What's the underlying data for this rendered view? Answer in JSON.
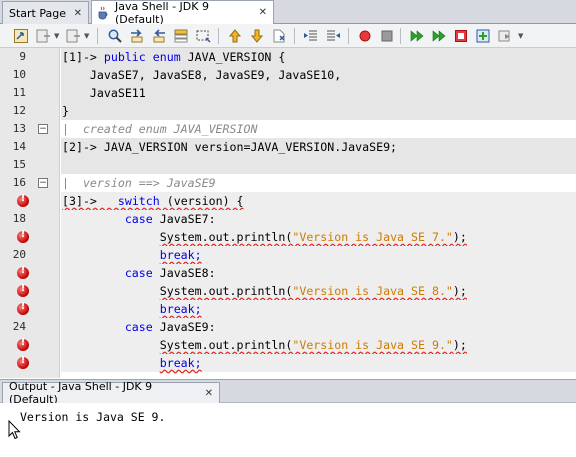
{
  "tabs": [
    {
      "label": "Start Page",
      "close": "✕"
    },
    {
      "label": "Java Shell - JDK 9 (Default)",
      "close": "✕"
    }
  ],
  "editor": {
    "lines": [
      {
        "num": "9",
        "marker": "",
        "bg": "shade",
        "html": [
          {
            "t": "[1]-> "
          },
          {
            "t": "public enum",
            "c": "kw"
          },
          {
            "t": " JAVA_VERSION {"
          }
        ]
      },
      {
        "num": "10",
        "marker": "",
        "bg": "shade",
        "html": [
          {
            "t": "    JavaSE7, JavaSE8, JavaSE9, JavaSE10,"
          }
        ]
      },
      {
        "num": "11",
        "marker": "",
        "bg": "shade",
        "html": [
          {
            "t": "    JavaSE11"
          }
        ]
      },
      {
        "num": "12",
        "marker": "",
        "bg": "shade",
        "html": [
          {
            "t": "}"
          }
        ]
      },
      {
        "num": "13",
        "marker": "fold",
        "bg": "",
        "html": [
          {
            "t": "|  created enum JAVA_VERSION",
            "c": "cm"
          }
        ]
      },
      {
        "num": "14",
        "marker": "",
        "bg": "shade",
        "html": [
          {
            "t": "[2]-> JAVA_VERSION version=JAVA_VERSION.JavaSE9;"
          }
        ]
      },
      {
        "num": "15",
        "marker": "",
        "bg": "shade",
        "html": [
          {
            "t": ""
          }
        ]
      },
      {
        "num": "16",
        "marker": "fold",
        "bg": "",
        "html": [
          {
            "t": "|  version ==> JavaSE9",
            "c": "cm"
          }
        ]
      },
      {
        "num": "",
        "marker": "err",
        "bg": "errbg",
        "html": [
          {
            "t": "[3]->  ",
            "w": 1
          },
          {
            "t": " switch",
            "c": "kw",
            "w": 1
          },
          {
            "t": " (version) {",
            "w": 1
          }
        ]
      },
      {
        "num": "18",
        "marker": "",
        "bg": "errbg",
        "html": [
          {
            "t": "         "
          },
          {
            "t": "case",
            "c": "kw"
          },
          {
            "t": " JavaSE7:"
          }
        ]
      },
      {
        "num": "",
        "marker": "err",
        "bg": "errbg",
        "html": [
          {
            "t": "              "
          },
          {
            "t": "System.out.println(",
            "w": 1
          },
          {
            "t": "\"Version is Java SE 7.\"",
            "c": "str",
            "w": 1
          },
          {
            "t": ");",
            "w": 1
          }
        ]
      },
      {
        "num": "20",
        "marker": "",
        "bg": "errbg",
        "html": [
          {
            "t": "              "
          },
          {
            "t": "break;",
            "c": "kw",
            "w": 1
          }
        ]
      },
      {
        "num": "",
        "marker": "err",
        "bg": "errbg",
        "html": [
          {
            "t": "         "
          },
          {
            "t": "case",
            "c": "kw"
          },
          {
            "t": " JavaSE8:"
          }
        ]
      },
      {
        "num": "",
        "marker": "err",
        "bg": "errbg",
        "html": [
          {
            "t": "              "
          },
          {
            "t": "System.out.println(",
            "w": 1
          },
          {
            "t": "\"Version is Java SE 8.\"",
            "c": "str",
            "w": 1
          },
          {
            "t": ");",
            "w": 1
          }
        ]
      },
      {
        "num": "",
        "marker": "err",
        "bg": "errbg",
        "html": [
          {
            "t": "              "
          },
          {
            "t": "break;",
            "c": "kw",
            "w": 1
          }
        ]
      },
      {
        "num": "24",
        "marker": "",
        "bg": "errbg",
        "html": [
          {
            "t": "         "
          },
          {
            "t": "case",
            "c": "kw"
          },
          {
            "t": " JavaSE9:"
          }
        ]
      },
      {
        "num": "",
        "marker": "err",
        "bg": "errbg",
        "html": [
          {
            "t": "              "
          },
          {
            "t": "System.out.println(",
            "w": 1
          },
          {
            "t": "\"Version is Java SE 9.\"",
            "c": "str",
            "w": 1
          },
          {
            "t": ");",
            "w": 1
          }
        ]
      },
      {
        "num": "",
        "marker": "err",
        "bg": "errbg",
        "html": [
          {
            "t": "              "
          },
          {
            "t": "break;",
            "c": "kw",
            "w": 1
          }
        ]
      }
    ]
  },
  "output": {
    "tab_label": "Output - Java Shell - JDK 9 (Default)",
    "close": "✕",
    "text": "Version is Java SE 9."
  },
  "colors": {
    "keyword": "#0000e6",
    "string": "#ce7b00",
    "comment": "#8a8a8a",
    "error": "#c00000"
  }
}
